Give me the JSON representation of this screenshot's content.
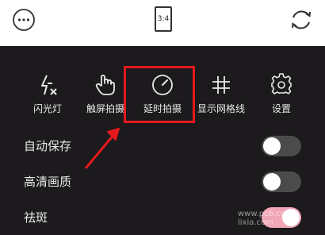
{
  "topbar": {
    "more_icon": "more-icon",
    "aspect_ratio": "3:4",
    "switch_camera_icon": "switch-camera-icon"
  },
  "tools": [
    {
      "label": "闪光灯",
      "icon": "flash-off-icon"
    },
    {
      "label": "触屏拍摄",
      "icon": "touch-icon"
    },
    {
      "label": "延时拍摄",
      "icon": "timer-icon"
    },
    {
      "label": "显示网格线",
      "icon": "grid-icon"
    },
    {
      "label": "设置",
      "icon": "gear-icon"
    }
  ],
  "settings": {
    "autosave": {
      "label": "自动保存",
      "enabled": false
    },
    "hd_quality": {
      "label": "高清画质",
      "enabled": false
    },
    "beauty": {
      "label": "祛斑",
      "enabled": true
    }
  },
  "colors": {
    "panel_bg": "#1c1a1c",
    "highlight": "#e5191d",
    "toggle_on": "#f1a6b7",
    "toggle_off": "#4b4b4b"
  },
  "watermark": "www.pc6.com / lixia.com"
}
